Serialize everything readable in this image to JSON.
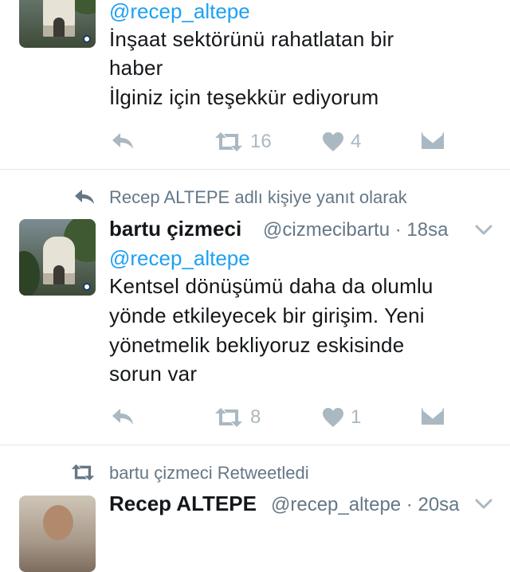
{
  "tweet1": {
    "mention": "@recep_altepe",
    "lines": [
      "İnşaat sektörünü rahatlatan bir",
      "haber",
      "İlginiz için teşekkür ediyorum"
    ],
    "retweets": "16",
    "likes": "4"
  },
  "tweet2": {
    "context": "Recep ALTEPE adlı kişiye yanıt olarak",
    "name": "bartu çizmeci",
    "handle_time": "@cizmecibartu · 18sa",
    "mention": "@recep_altepe",
    "lines": [
      "Kentsel dönüşümü daha da olumlu",
      "yönde etkileyecek bir girişim. Yeni",
      "yönetmelik bekliyoruz eskisinde",
      "sorun var"
    ],
    "retweets": "8",
    "likes": "1"
  },
  "tweet3": {
    "context": "bartu çizmeci Retweetledi",
    "name": "Recep ALTEPE",
    "handle_time": "@recep_altepe · 20sa"
  },
  "icons": {
    "reply": "reply-arrow-icon",
    "retweet": "retweet-icon",
    "like": "heart-icon",
    "dm": "envelope-icon",
    "chevron": "chevron-down-icon"
  },
  "colors": {
    "link": "#1da1f2",
    "muted": "#657786",
    "action": "#aab8c2",
    "divider": "#e1e8ed"
  }
}
